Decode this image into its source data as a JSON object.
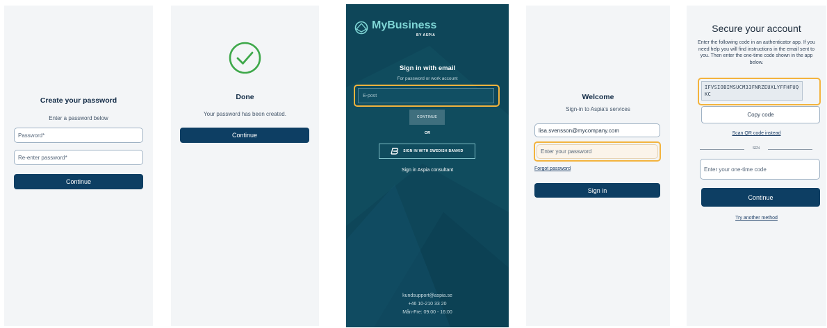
{
  "panel1": {
    "title": "Create your password",
    "subtitle": "Enter a password below",
    "password_placeholder": "Password*",
    "reenter_placeholder": "Re-enter password*",
    "continue_label": "Continue"
  },
  "panel2": {
    "title": "Done",
    "message": "Your password has been created.",
    "continue_label": "Continue"
  },
  "panel3": {
    "brand_name": "MyBusiness",
    "brand_sub": "BY ASPIA",
    "title": "Sign in with email",
    "subtitle": "For password or work account",
    "email_placeholder": "E-post",
    "continue_label": "CONTINUE",
    "or_label": "OR",
    "bankid_label": "SIGN IN WITH SWEDISH BANKID",
    "consultant_label": "Sign in Aspia consultant",
    "support_email": "kundsupport@aspia.se",
    "support_phone": "+46 10-210 33 20",
    "support_hours": "Mån-Fre: 09:00 - 16:00"
  },
  "panel4": {
    "title": "Welcome",
    "subtitle": "Sign-in to Aspia's services",
    "email_value": "lisa.svensson@mycompany.com",
    "password_placeholder": "Enter your password",
    "forgot_label": "Forgot password",
    "signin_label": "Sign in"
  },
  "panel5": {
    "title": "Secure your account",
    "instructions": "Enter the following code in an authenticator app. If you need help you will find instructions in the email sent to you. Then enter the one-time code shown in the app below.",
    "code": "IFVSIOBIMSUCM33FNRZEUXLYFFHFUQKC",
    "copy_label": "Copy code",
    "scan_label": "Scan QR code instead",
    "divider_label": "SEN",
    "otp_placeholder": "Enter your one-time code",
    "continue_label": "Continue",
    "other_method_label": "Try another method"
  },
  "colors": {
    "primary": "#0d3e63",
    "highlight": "#f3b33d",
    "dark_panel": "#0e4659",
    "success": "#3ea84a"
  }
}
